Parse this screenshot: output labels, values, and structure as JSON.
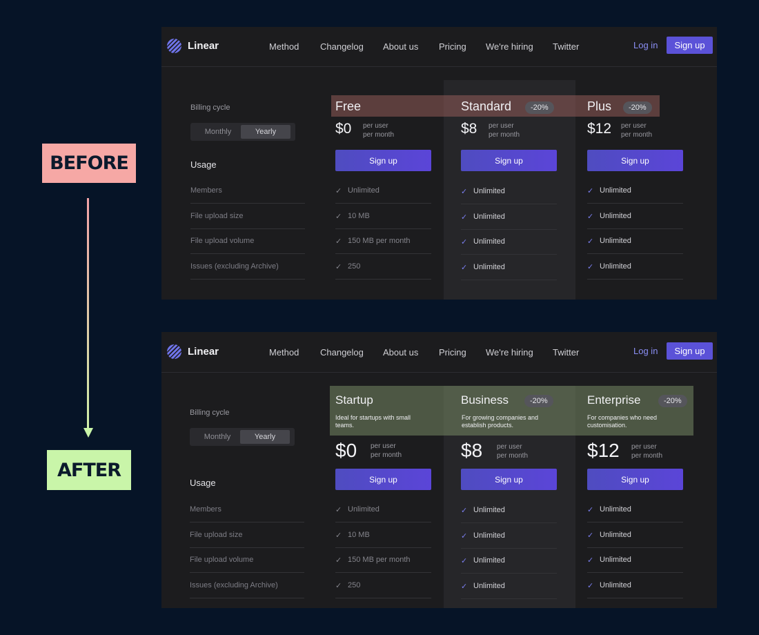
{
  "labels": {
    "before": "BEFORE",
    "after": "AFTER"
  },
  "nav": {
    "brand": "Linear",
    "items": [
      "Method",
      "Changelog",
      "About us",
      "Pricing",
      "We're hiring",
      "Twitter"
    ],
    "login": "Log in",
    "signup": "Sign up"
  },
  "billing": {
    "label": "Billing cycle",
    "monthly": "Monthly",
    "yearly": "Yearly"
  },
  "usage": {
    "title": "Usage",
    "features": [
      "Members",
      "File upload size",
      "File upload volume",
      "Issues (excluding Archive)"
    ]
  },
  "before": {
    "tiers": [
      {
        "name": "Free",
        "badge": "",
        "price": "$0",
        "per_line1": "per user",
        "per_line2": "per month",
        "cta": "Sign up",
        "values": [
          "Unlimited",
          "10 MB",
          "150 MB per month",
          "250"
        ]
      },
      {
        "name": "Standard",
        "badge": "-20%",
        "price": "$8",
        "per_line1": "per user",
        "per_line2": "per month",
        "cta": "Sign up",
        "values": [
          "Unlimited",
          "Unlimited",
          "Unlimited",
          "Unlimited"
        ]
      },
      {
        "name": "Plus",
        "badge": "-20%",
        "price": "$12",
        "per_line1": "per user",
        "per_line2": "per month",
        "cta": "Sign up",
        "values": [
          "Unlimited",
          "Unlimited",
          "Unlimited",
          "Unlimited"
        ]
      }
    ]
  },
  "after": {
    "tiers": [
      {
        "name": "Startup",
        "badge": "",
        "desc_line1": "Ideal for startups with small",
        "desc_line2": "teams.",
        "price": "$0",
        "per_line1": "per user",
        "per_line2": "per month",
        "cta": "Sign up",
        "values": [
          "Unlimited",
          "10 MB",
          "150 MB per month",
          "250"
        ]
      },
      {
        "name": "Business",
        "badge": "-20%",
        "desc_line1": "For growing companies and",
        "desc_line2": "establish products.",
        "price": "$8",
        "per_line1": "per user",
        "per_line2": "per month",
        "cta": "Sign up",
        "values": [
          "Unlimited",
          "Unlimited",
          "Unlimited",
          "Unlimited"
        ]
      },
      {
        "name": "Enterprise",
        "badge": "-20%",
        "desc_line1": "For companies who need",
        "desc_line2": "customisation.",
        "price": "$12",
        "per_line1": "per user",
        "per_line2": "per month",
        "cta": "Sign up",
        "values": [
          "Unlimited",
          "Unlimited",
          "Unlimited",
          "Unlimited"
        ]
      }
    ]
  },
  "check_icon": "check-icon",
  "colors": {
    "accent": "#5b52d8",
    "background": "#061427",
    "panel": "#1c1c1e"
  }
}
